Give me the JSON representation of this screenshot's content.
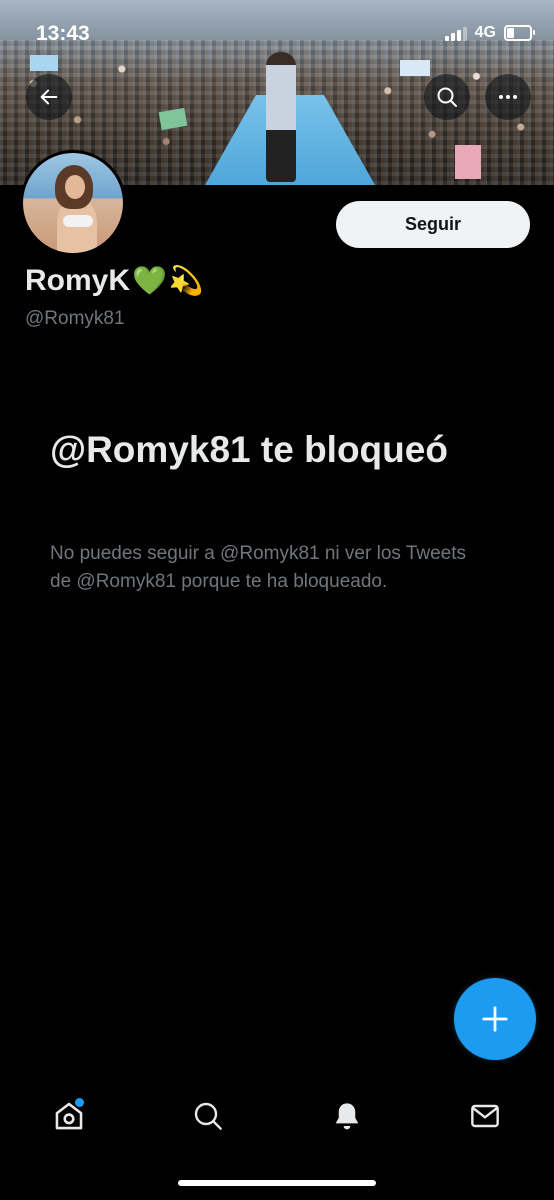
{
  "status_bar": {
    "time": "13:43",
    "network": "4G",
    "battery_level": 0.3
  },
  "profile": {
    "display_name": "RomyK",
    "name_emojis": [
      "💚",
      "💫"
    ],
    "handle": "@Romyk81",
    "follow_label": "Seguir"
  },
  "blocked": {
    "title": "@Romyk81 te bloqueó",
    "body": "No puedes seguir a @Romyk81 ni ver los Tweets de @Romyk81 porque te ha bloqueado."
  },
  "icons": {
    "back": "arrow-left-icon",
    "search": "search-icon",
    "more": "more-horizontal-icon",
    "compose": "plus-icon",
    "home": "home-icon",
    "explore": "search-icon",
    "notifications": "bell-icon",
    "messages": "mail-icon"
  },
  "colors": {
    "accent": "#1d9bf0",
    "background": "#000000",
    "secondary_text": "#71767b"
  }
}
